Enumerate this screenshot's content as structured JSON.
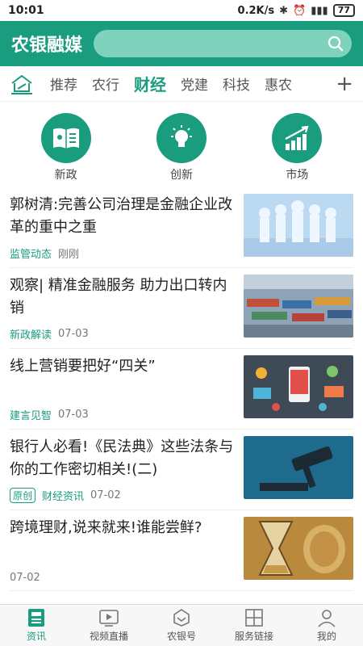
{
  "statusbar": {
    "time": "10:01",
    "speed": "0.2K/s",
    "battery": "77"
  },
  "app": {
    "title": "农银融媒"
  },
  "tabs": [
    {
      "label": "推荐"
    },
    {
      "label": "农行"
    },
    {
      "label": "财经"
    },
    {
      "label": "党建"
    },
    {
      "label": "科技"
    },
    {
      "label": "惠农"
    }
  ],
  "quick": [
    {
      "label": "新政",
      "icon": "book-icon"
    },
    {
      "label": "创新",
      "icon": "lightbulb-icon"
    },
    {
      "label": "市场",
      "icon": "chart-icon"
    }
  ],
  "news": [
    {
      "title": "郭树清:完善公司治理是金融企业改革的重中之重",
      "tag": "监管动态",
      "time": "刚刚"
    },
    {
      "title": "观察| 精准金融服务  助力出口转内销",
      "tag": "新政解读",
      "time": "07-03"
    },
    {
      "title": "线上营销要把好“四关”",
      "tag": "建言见智",
      "time": "07-03"
    },
    {
      "title": "银行人必看!《民法典》这些法条与你的工作密切相关!(二)",
      "badge": "原创",
      "tag": "财经资讯",
      "time": "07-02"
    },
    {
      "title": "跨境理财,说来就来!谁能尝鲜?",
      "time": "07-02"
    }
  ],
  "bottomnav": [
    {
      "label": "资讯"
    },
    {
      "label": "视频直播"
    },
    {
      "label": "农银号"
    },
    {
      "label": "服务链接"
    },
    {
      "label": "我的"
    }
  ],
  "colors": {
    "brand": "#1a9c7f"
  }
}
